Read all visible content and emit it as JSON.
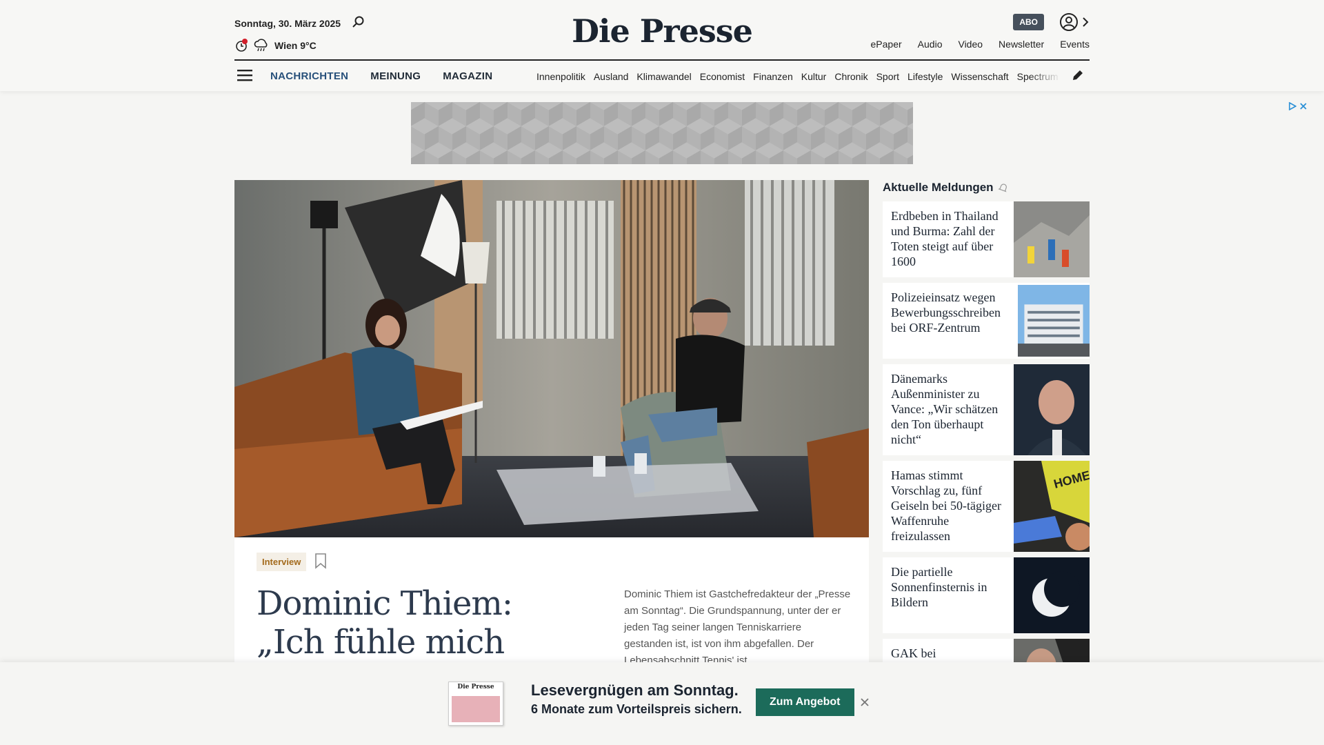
{
  "header": {
    "date": "Sonntag, 30. März 2025",
    "weather": "Wien 9°C",
    "logo": "Die Presse",
    "abo_label": "ABO",
    "topnav": [
      "ePaper",
      "Audio",
      "Video",
      "Newsletter",
      "Events"
    ],
    "sections": [
      "NACHRICHTEN",
      "MEINUNG",
      "MAGAZIN"
    ],
    "subnav": [
      "Innenpolitik",
      "Ausland",
      "Klimawandel",
      "Economist",
      "Finanzen",
      "Kultur",
      "Chronik",
      "Sport",
      "Lifestyle",
      "Wissenschaft",
      "Spectrum"
    ]
  },
  "article": {
    "tag": "Interview",
    "headline": "Dominic Thiem: „Ich fühle mich leichter",
    "lead": "Dominic Thiem ist Gastchefredakteur der „Presse am Sonntag“. Die Grundspannung, unter der er jeden Tag seiner langen Tenniskarriere gestanden ist, ist von ihm abgefallen. Der Lebensabschnitt Tennis' ist"
  },
  "sidebar": {
    "title": "Aktuelle Meldungen",
    "items": [
      {
        "text": "Erdbeben in Thailand und Burma: Zahl der Toten steigt auf über 1600"
      },
      {
        "text": "Polizeieinsatz wegen Bewerbungsschreiben bei ORF-Zentrum"
      },
      {
        "text": "Dänemarks Außenminister zu Vance: „Wir schätzen den Ton überhaupt nicht“"
      },
      {
        "text": "Hamas stimmt Vorschlag zu, fünf Geiseln bei 50-tägiger Waffenruhe freizulassen"
      },
      {
        "text": "Die partielle Sonnenfinsternis in Bildern"
      },
      {
        "text": "GAK bei"
      }
    ]
  },
  "promo": {
    "cover_logo": "Die Presse",
    "title": "Lesevergnügen am Sonntag.",
    "subtitle": "6 Monate zum Vorteilspreis sichern.",
    "button": "Zum Angebot"
  },
  "colors": {
    "accent_nav": "#27507a",
    "promo_button": "#1c6b5a",
    "tag_text": "#a36a1c"
  }
}
